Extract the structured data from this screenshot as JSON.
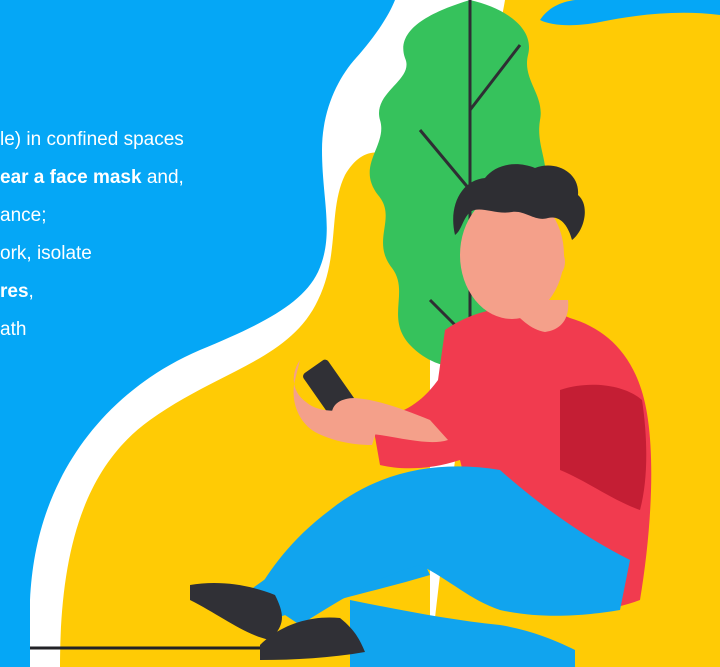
{
  "colors": {
    "blue": "#05a7f6",
    "yellow": "#ffcb05",
    "green": "#36c25c",
    "shirt": "#f13b4f",
    "shirt_shadow": "#c41e34",
    "skin": "#f4a08a",
    "hair": "#2e2e33",
    "jeans": "#11a4ee",
    "shoe": "#303036",
    "ground": "#222226"
  },
  "message": {
    "lines": [
      {
        "before": "le) in confined spaces",
        "strong": "",
        "after": ""
      },
      {
        "before": "",
        "strong": "ear a face mask",
        "after": " and,"
      },
      {
        "before": "ance;",
        "strong": "",
        "after": ""
      },
      {
        "before": "ork, isolate",
        "strong": "",
        "after": ""
      },
      {
        "before": "",
        "strong": "res",
        "after": ","
      },
      {
        "before": "ath",
        "strong": "",
        "after": ""
      }
    ]
  }
}
